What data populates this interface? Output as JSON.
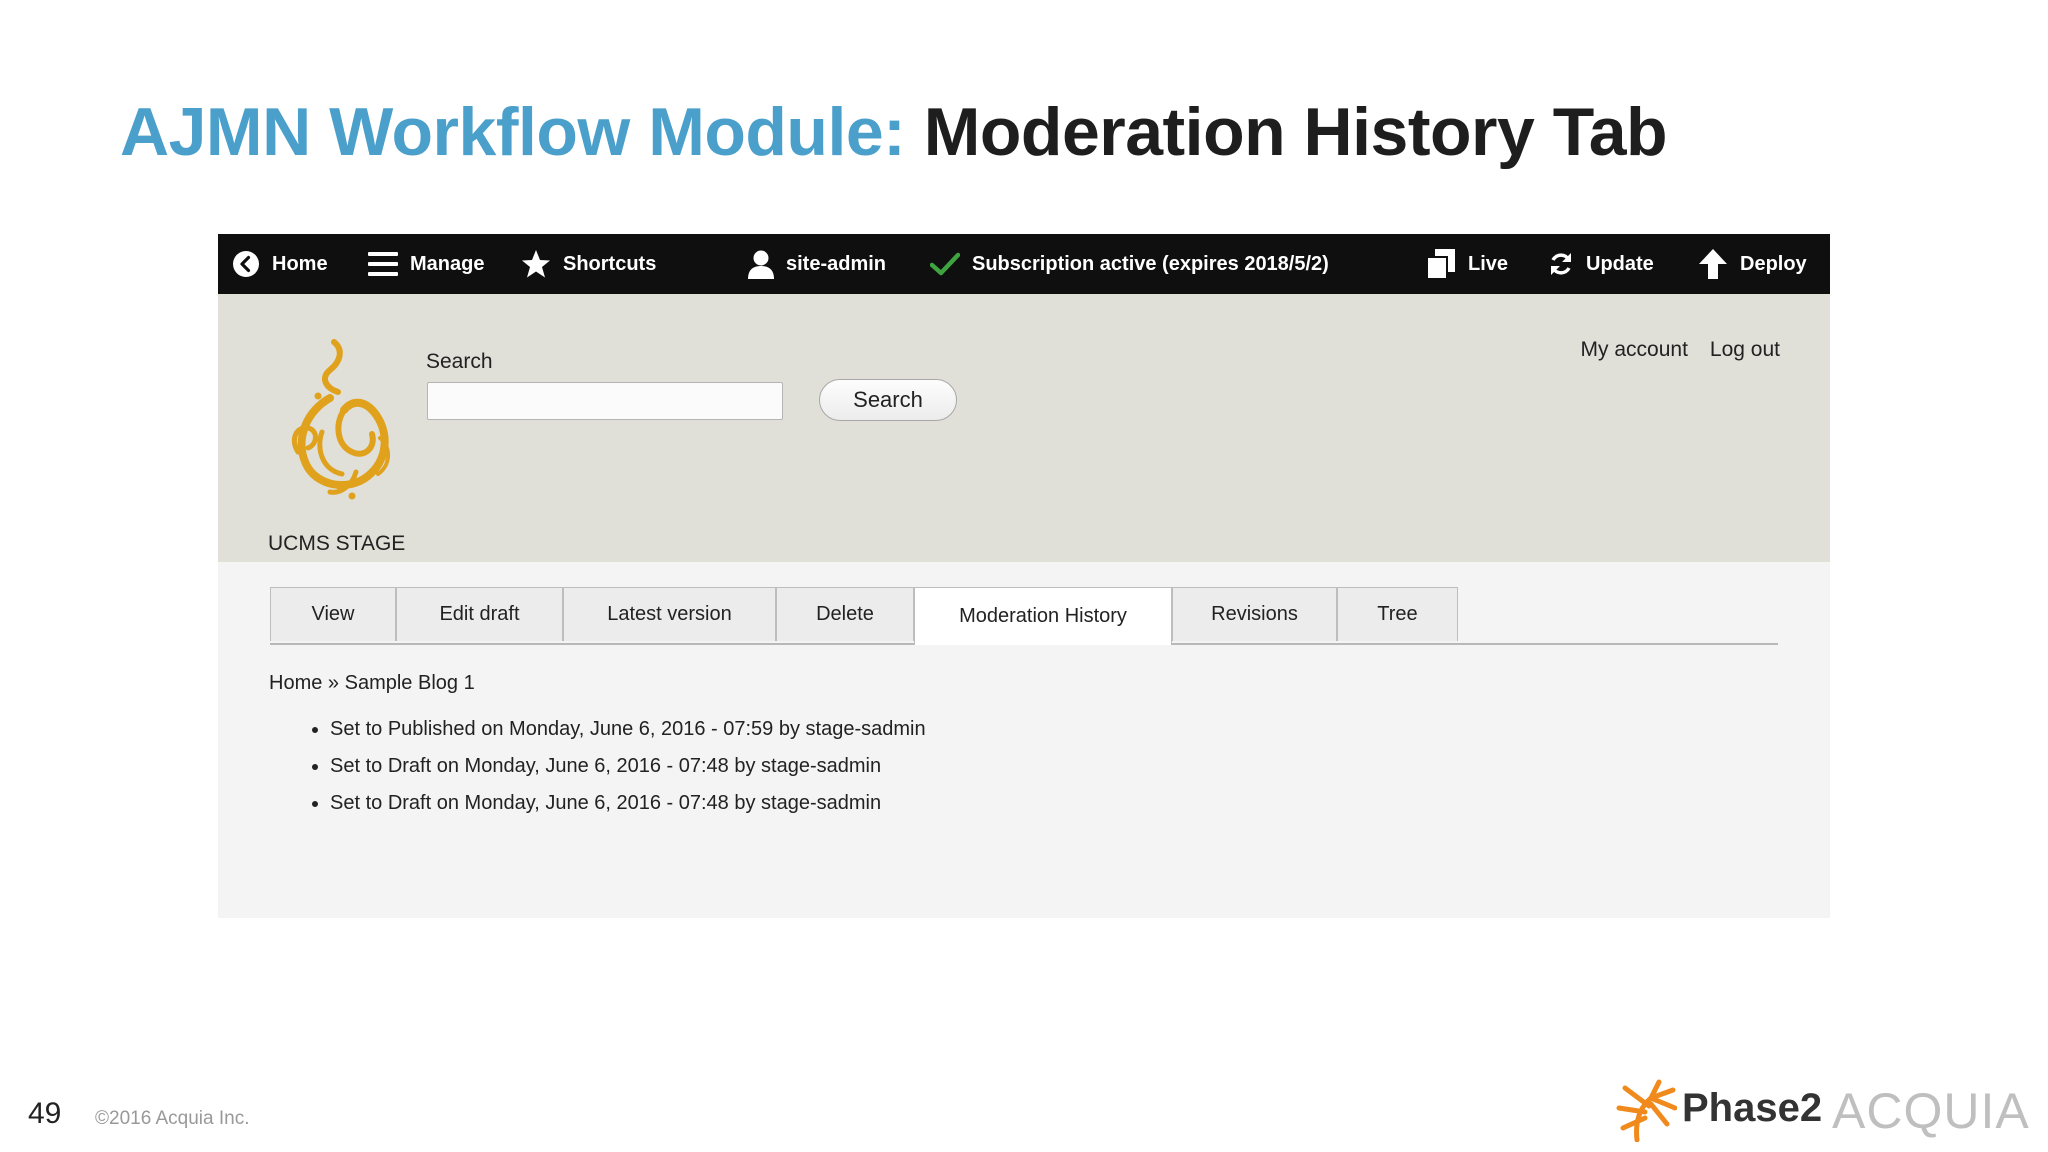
{
  "slide": {
    "title_prefix": "AJMN Workflow Module:",
    "title_main": "Moderation History Tab",
    "page_number": "49",
    "copyright": "©2016 Acquia Inc.",
    "logos": {
      "phase2": "Phase2",
      "acquia": "ACQUIA"
    }
  },
  "toolbar": {
    "items": [
      {
        "label": "Home",
        "icon": "back-circle-icon"
      },
      {
        "label": "Manage",
        "icon": "hamburger-menu-icon"
      },
      {
        "label": "Shortcuts",
        "icon": "star-icon"
      },
      {
        "label": "site-admin",
        "icon": "user-icon"
      },
      {
        "label": "Subscription active (expires 2018/5/2)",
        "icon": "checkmark-icon",
        "icon_color": "#3fa33f"
      },
      {
        "label": "Live",
        "icon": "copy-pages-icon"
      },
      {
        "label": "Update",
        "icon": "refresh-icon"
      },
      {
        "label": "Deploy",
        "icon": "arrow-up-icon"
      }
    ]
  },
  "header": {
    "site_name": "UCMS STAGE",
    "search": {
      "label": "Search",
      "value": "",
      "placeholder": "",
      "button_label": "Search"
    },
    "user_links": [
      "My account",
      "Log out"
    ],
    "logo_icon": "al-jazeera-calligraphy-logo",
    "logo_color": "#e0a21d"
  },
  "tabs": [
    {
      "label": "View",
      "active": false
    },
    {
      "label": "Edit draft",
      "active": false
    },
    {
      "label": "Latest version",
      "active": false
    },
    {
      "label": "Delete",
      "active": false
    },
    {
      "label": "Moderation History",
      "active": true
    },
    {
      "label": "Revisions",
      "active": false
    },
    {
      "label": "Tree",
      "active": false
    }
  ],
  "breadcrumb": {
    "home": "Home",
    "separator": "»",
    "current": "Sample Blog 1"
  },
  "history": [
    {
      "prefix": "Set to",
      "state": "Published",
      "details": "on Monday, June 6, 2016 - 07:59 by stage-sadmin"
    },
    {
      "prefix": "Set to",
      "state": "Draft",
      "details": "on Monday, June 6, 2016 - 07:48 by stage-sadmin"
    },
    {
      "prefix": "Set to",
      "state": "Draft",
      "details": "on Monday, June 6, 2016 - 07:48 by stage-sadmin"
    }
  ],
  "colors": {
    "title_accent": "#4a9fcb",
    "toolbar_bg": "#0f0f0f",
    "header_bg": "#e0dfd8",
    "content_bg": "#f4f4f4",
    "phase2_orange": "#f08a1c"
  }
}
